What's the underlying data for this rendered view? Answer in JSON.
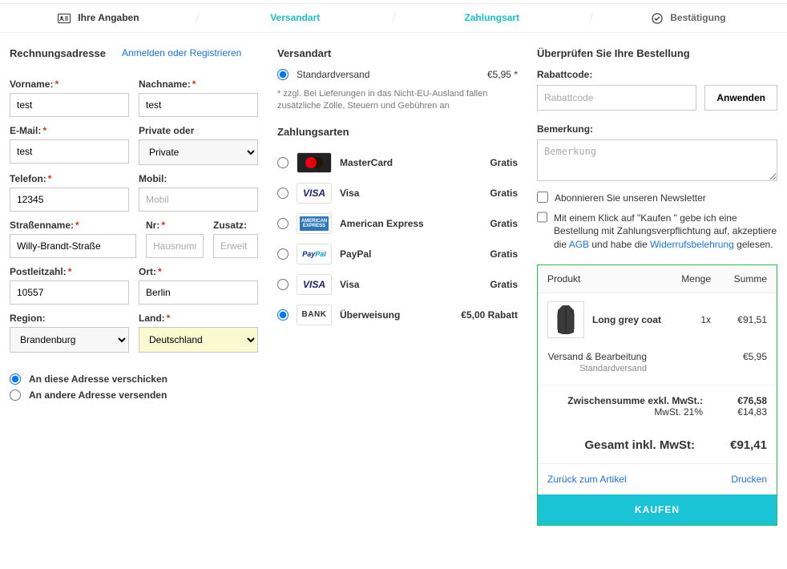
{
  "steps": {
    "s1": "Ihre Angaben",
    "s2": "Versandart",
    "s3": "Zahlungsart",
    "s4": "Bestätigung"
  },
  "billing": {
    "title": "Rechnungsadresse",
    "login_link": "Anmelden oder Registrieren",
    "firstname_label": "Vorname:",
    "firstname": "test",
    "lastname_label": "Nachname:",
    "lastname": "test",
    "email_label": "E-Mail:",
    "email": "test",
    "privoder_label": "Private oder",
    "privoder_value": "Private",
    "phone_label": "Telefon:",
    "phone": "12345",
    "mobile_label": "Mobil:",
    "mobile_ph": "Mobil",
    "street_label": "Straßenname:",
    "street": "Willy-Brandt-Straße",
    "nr_label": "Nr:",
    "nr_ph": "Hausnumme",
    "zusatz_label": "Zusatz:",
    "zusatz_ph": "Erweit",
    "zip_label": "Postleitzahl:",
    "zip": "10557",
    "city_label": "Ort:",
    "city": "Berlin",
    "region_label": "Region:",
    "region_value": "Brandenburg",
    "country_label": "Land:",
    "country_value": "Deutschland",
    "ship_same": "An diese Adresse verschicken",
    "ship_other": "An andere Adresse versenden"
  },
  "shipping": {
    "title": "Versandart",
    "option": "Standardversand",
    "price": "€5,95 *",
    "note": "* zzgl. Bei Lieferungen in das Nicht-EU-Ausland fallen zusätzliche Zölle, Steuern und Gebühren an"
  },
  "payment": {
    "title": "Zahlungsarten",
    "free": "Gratis",
    "methods": {
      "mc": "MasterCard",
      "visa": "Visa",
      "amex": "American Express",
      "paypal": "PayPal",
      "visa2": "Visa",
      "bank": "Überweisung",
      "bank_price": "€5,00 Rabatt"
    }
  },
  "review": {
    "title": "Überprüfen Sie Ihre Bestellung",
    "discount_label": "Rabattcode:",
    "discount_ph": "Rabattcode",
    "apply": "Anwenden",
    "remark_label": "Bemerkung:",
    "remark_ph": "Bemerkung",
    "newsletter": "Abonnieren Sie unseren Newsletter",
    "terms_pre": "Mit einem Klick auf \"Kaufen \" gebe ich eine Bestellung mit Zahlungsverpflichtung auf, akzeptiere die ",
    "terms_agb": "AGB",
    "terms_mid": " und habe die ",
    "terms_wider": "Widerrufsbelehrung",
    "terms_post": " gelesen."
  },
  "order": {
    "head_product": "Produkt",
    "head_qty": "Menge",
    "head_sum": "Summe",
    "item_name": "Long grey coat",
    "item_qty": "1x",
    "item_sum": "€91,51",
    "ship_label": "Versand & Bearbeitung",
    "ship_sub": "Standardversand",
    "ship_sum": "€5,95",
    "subtotal_label": "Zwischensumme exkl. MwSt.:",
    "subtotal": "€76,58",
    "vat_label": "MwSt. 21%",
    "vat": "€14,83",
    "grand_label": "Gesamt inkl. MwSt:",
    "grand": "€91,41",
    "back": "Zurück zum Artikel",
    "print": "Drucken",
    "buy": "KAUFEN"
  }
}
